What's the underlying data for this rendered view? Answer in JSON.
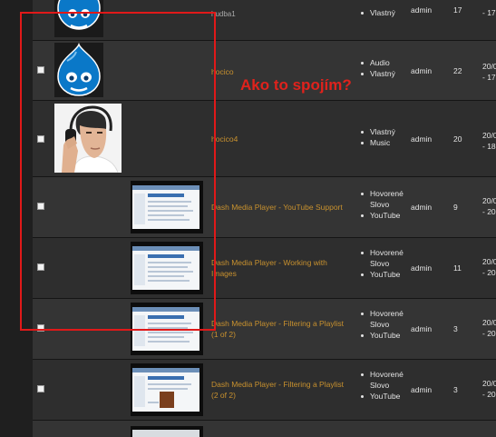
{
  "annotation": {
    "text": "Ako to spojím?",
    "color": "#e01919"
  },
  "rows": [
    {
      "title": "hudba1",
      "terms": [
        "Vlastný"
      ],
      "author": "admin",
      "count": "17",
      "date": [
        "- 17"
      ]
    },
    {
      "title": "hocico",
      "terms": [
        "Audio",
        "Vlastný"
      ],
      "author": "admin",
      "count": "22",
      "date": [
        "20/0",
        "- 17"
      ]
    },
    {
      "title": "hocico4",
      "terms": [
        "Vlastný",
        "Music"
      ],
      "author": "admin",
      "count": "20",
      "date": [
        "20/0",
        "- 18"
      ]
    },
    {
      "title": "Dash Media Player - YouTube Support",
      "terms": [
        "Hovorené Slovo",
        "YouTube"
      ],
      "author": "admin",
      "count": "9",
      "date": [
        "20/0",
        "- 20"
      ]
    },
    {
      "title": "Dash Media Player - Working with Images",
      "terms": [
        "Hovorené Slovo",
        "YouTube"
      ],
      "author": "admin",
      "count": "11",
      "date": [
        "20/0",
        "- 20"
      ]
    },
    {
      "title": "Dash Media Player - Filtering a Playlist (1 of 2)",
      "terms": [
        "Hovorené Slovo",
        "YouTube"
      ],
      "author": "admin",
      "count": "3",
      "date": [
        "20/0",
        "- 20"
      ]
    },
    {
      "title": "Dash Media Player - Filtering a Playlist (2 of 2)",
      "terms": [
        "Hovorené Slovo",
        "YouTube"
      ],
      "author": "admin",
      "count": "3",
      "date": [
        "20/0",
        "- 20"
      ]
    }
  ],
  "icons": {
    "drupal": "drupal-logo-icon",
    "checkbox": "checkbox"
  },
  "colors": {
    "title_link": "#c8912e",
    "drupal_blue": "#0a78c8"
  }
}
